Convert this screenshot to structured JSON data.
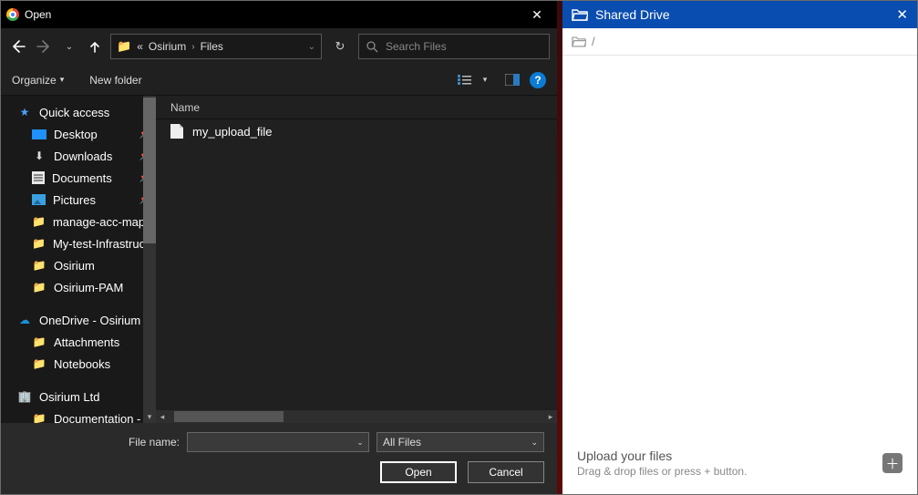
{
  "dialog": {
    "title": "Open",
    "breadcrumb": {
      "sep": "«",
      "a": "Osirium",
      "b": "Files"
    },
    "search_placeholder": "Search Files",
    "toolbar": {
      "organize": "Organize",
      "new_folder": "New folder",
      "help": "?"
    },
    "sidebar": {
      "quick_access": "Quick access",
      "quick_items": [
        {
          "label": "Desktop"
        },
        {
          "label": "Downloads"
        },
        {
          "label": "Documents"
        },
        {
          "label": "Pictures"
        },
        {
          "label": "manage-acc-mappings"
        },
        {
          "label": "My-test-Infrastructure"
        },
        {
          "label": "Osirium"
        },
        {
          "label": "Osirium-PAM"
        }
      ],
      "onedrive": "OneDrive - Osirium",
      "onedrive_items": [
        {
          "label": "Attachments"
        },
        {
          "label": "Notebooks"
        }
      ],
      "company": "Osirium Ltd",
      "company_items": [
        {
          "label": "Documentation -"
        }
      ]
    },
    "list": {
      "header_name": "Name",
      "file0": "my_upload_file"
    },
    "bottom": {
      "filename_label": "File name:",
      "filter": "All Files",
      "open": "Open",
      "cancel": "Cancel"
    }
  },
  "panel": {
    "title": "Shared Drive",
    "crumb_root": "/",
    "footer_title": "Upload your files",
    "footer_sub": "Drag & drop files or press + button."
  }
}
